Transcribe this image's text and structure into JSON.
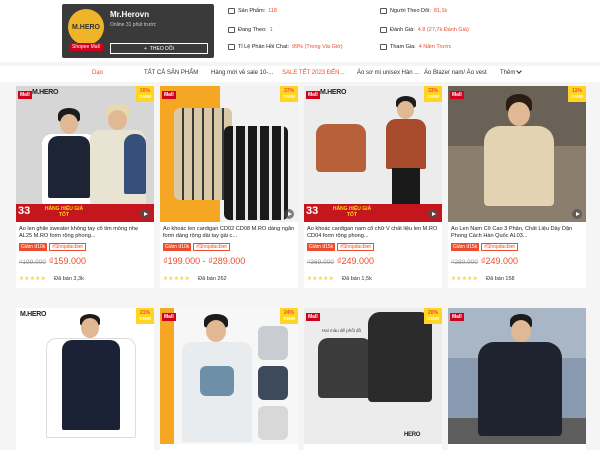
{
  "shop": {
    "logo_text": "M.HERO",
    "mall_badge": "Shopee Mall",
    "name": "Mr.Herovn",
    "status": "Online 31 phút trước",
    "follow_label": "THEO DÕI"
  },
  "stats": {
    "products_label": "Sản Phẩm:",
    "products_value": "118",
    "following_label": "Đang Theo:",
    "following_value": "1",
    "response_label": "Tỉ Lệ Phản Hồi Chat:",
    "response_value": "99% (Trong Vài Giờ)",
    "followers_label": "Người Theo Dõi:",
    "followers_value": "81,1k",
    "rating_label": "Đánh Giá:",
    "rating_value": "4.8 (27,7k Đánh Giá)",
    "joined_label": "Tham Gia:",
    "joined_value": "4 Năm Trước"
  },
  "nav": {
    "items": [
      "Dạo",
      "TẤT CẢ SẢN PHẨM",
      "Hàng mới về sale 10-...",
      "SALE TẾT 2023 ĐẾN...",
      "Áo sơ mi unisex Hàn ...",
      "Áo Blazer nam/ Áo vest",
      "Thêm"
    ]
  },
  "products": [
    {
      "discount": "20%",
      "discount_word": "GIẢM",
      "brand": "M.HERO",
      "promo_num": "33",
      "promo_text": "HÀNG HIỆU GIÁ TỐT",
      "title": "Áo len ghile sweater không tay cổ tim mỏng nhẹ AL25 M.RO form rộng phong...",
      "tag": "Giảm đ10k",
      "tag2": "#Shopdacbiet",
      "old_price": "₫199.000",
      "price": "₫159.000",
      "sold": "Đã bán 3,3k"
    },
    {
      "discount": "37%",
      "discount_word": "GIẢM",
      "title": "Áo khoác len cardigan CD02 CD08 M.RO dáng ngắn form dáng rộng dài tay gài c...",
      "tag": "Giảm đ10k",
      "tag2": "#Shopdacbiet",
      "price_from": "₫199.000",
      "price_to": "₫289.000",
      "sold": "Đã bán 262"
    },
    {
      "discount": "33%",
      "discount_word": "GIẢM",
      "brand": "M.HERO",
      "promo_num": "33",
      "promo_text": "HÀNG HIỆU GIÁ TỐT",
      "title": "Áo khoác cardigan nam cổ chữ V chất liệu len M.RO CD04 form rộng phong...",
      "tag": "Giảm đ15k",
      "tag2": "#Shopdacbiet",
      "old_price": "₫369.000",
      "price": "₫249.000",
      "sold": "Đã bán 1,5k"
    },
    {
      "discount": "11%",
      "discount_word": "GIẢM",
      "title": "Áo Len Nam Cổ Cao 3 Phân, Chất Liệu Dày Dặn Phong Cách Hàn Quốc AL03...",
      "tag": "Giảm đ15k",
      "tag2": "#Shopdacbiet",
      "old_price": "₫280.000",
      "price": "₫249.000",
      "sold": "Đã bán 158"
    },
    {
      "discount": "21%",
      "discount_word": "GIẢM",
      "brand": "M.HERO"
    },
    {
      "discount": "24%",
      "discount_word": "GIẢM"
    },
    {
      "discount": "20%",
      "discount_word": "GIẢM",
      "caption": "Hai màu để phối đồ",
      "brand": "HERO"
    },
    {
      "discount": "",
      "discount_word": ""
    }
  ],
  "common": {
    "mall": "Mall",
    "stars": "★★★★★"
  },
  "colors": {
    "accent": "#ee4d2d",
    "mall": "#d0011b",
    "promo": "#c4161c",
    "badge": "#ffd424"
  }
}
